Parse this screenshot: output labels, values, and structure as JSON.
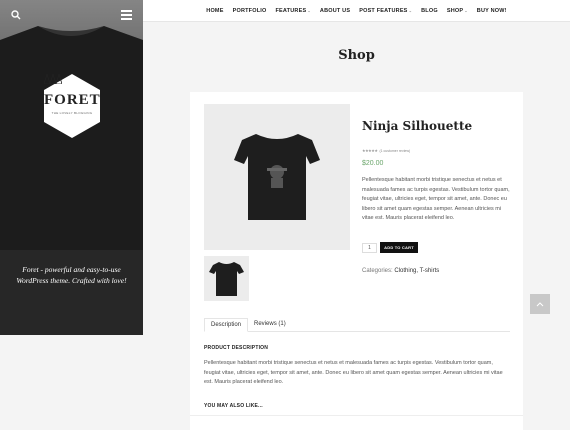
{
  "nav": {
    "items": [
      {
        "label": "HOME",
        "dropdown": false
      },
      {
        "label": "PORTFOLIO",
        "dropdown": false
      },
      {
        "label": "FEATURES",
        "dropdown": true
      },
      {
        "label": "ABOUT US",
        "dropdown": false
      },
      {
        "label": "POST FEATURES",
        "dropdown": true
      },
      {
        "label": "BLOG",
        "dropdown": false
      },
      {
        "label": "SHOP",
        "dropdown": true
      },
      {
        "label": "BUY NOW!",
        "dropdown": false
      }
    ]
  },
  "sidebar": {
    "logo_title": "FORET",
    "logo_subtitle": "THE LOVELY BLOGGING",
    "tagline": "Foret - powerful and easy-to-use WordPress theme. Crafted with love!"
  },
  "page": {
    "title": "Shop"
  },
  "product": {
    "title": "Ninja Silhouette",
    "rating_text": "(1 customer review)",
    "rating_value": 5,
    "price": "$20.00",
    "short_description": "Pellentesque habitant morbi tristique senectus et netus et malesuada fames ac turpis egestas. Vestibulum tortor quam, feugiat vitae, ultricies eget, tempor sit amet, ante. Donec eu libero sit amet quam egestas semper. Aenean ultricies mi vitae est. Mauris placerat eleifend leo.",
    "quantity": "1",
    "add_to_cart_label": "ADD TO CART",
    "categories_label": "Categories:",
    "categories": "Clothing, T-shirts"
  },
  "tabs": [
    {
      "label": "Description",
      "active": true
    },
    {
      "label": "Reviews (1)",
      "active": false
    }
  ],
  "description": {
    "heading": "PRODUCT DESCRIPTION",
    "text": "Pellentesque habitant morbi tristique senectus et netus et malesuada fames ac turpis egestas. Vestibulum tortor quam, feugiat vitae, ultricies eget, tempor sit amet, ante. Donec eu libero sit amet quam egestas semper. Aenean ultricies mi vitae est. Mauris placerat eleifend leo."
  },
  "related": {
    "heading": "YOU MAY ALSO LIKE..."
  },
  "colors": {
    "price": "#6aa56a",
    "button": "#111111",
    "scroll_top": "#c8c8c8"
  },
  "icons": {
    "search": "search-icon",
    "menu": "hamburger-menu-icon",
    "scroll_top": "chevron-up-icon"
  }
}
